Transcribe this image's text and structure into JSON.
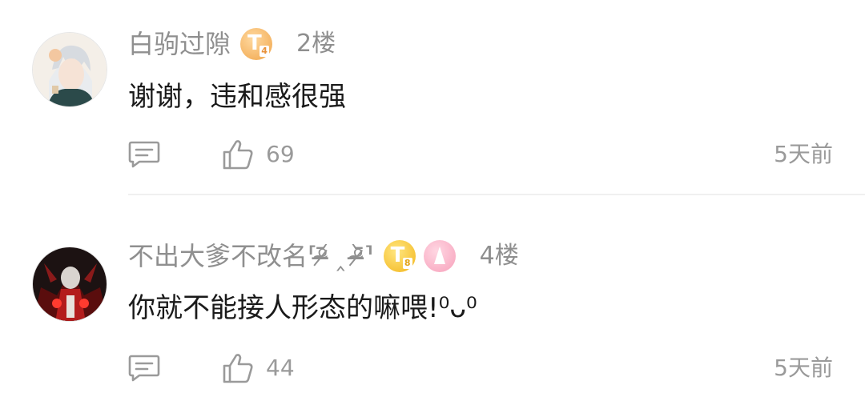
{
  "comments": [
    {
      "username": "白驹过隙",
      "badge_level": "4",
      "floor": "2楼",
      "content": "谢谢，违和感很强",
      "likes": "69",
      "time": "5天前"
    },
    {
      "username": "不出大爹不改名⸢ᵒ̴̶̷᷄ ‸ ᵒ̴̶̷᷅⸣",
      "badge_level": "8",
      "floor": "4楼",
      "content": "你就不能接人形态的嘛喂!⁰ᴗ⁰",
      "likes": "44",
      "time": "5天前"
    }
  ],
  "badges": {
    "t_letter": "T"
  }
}
